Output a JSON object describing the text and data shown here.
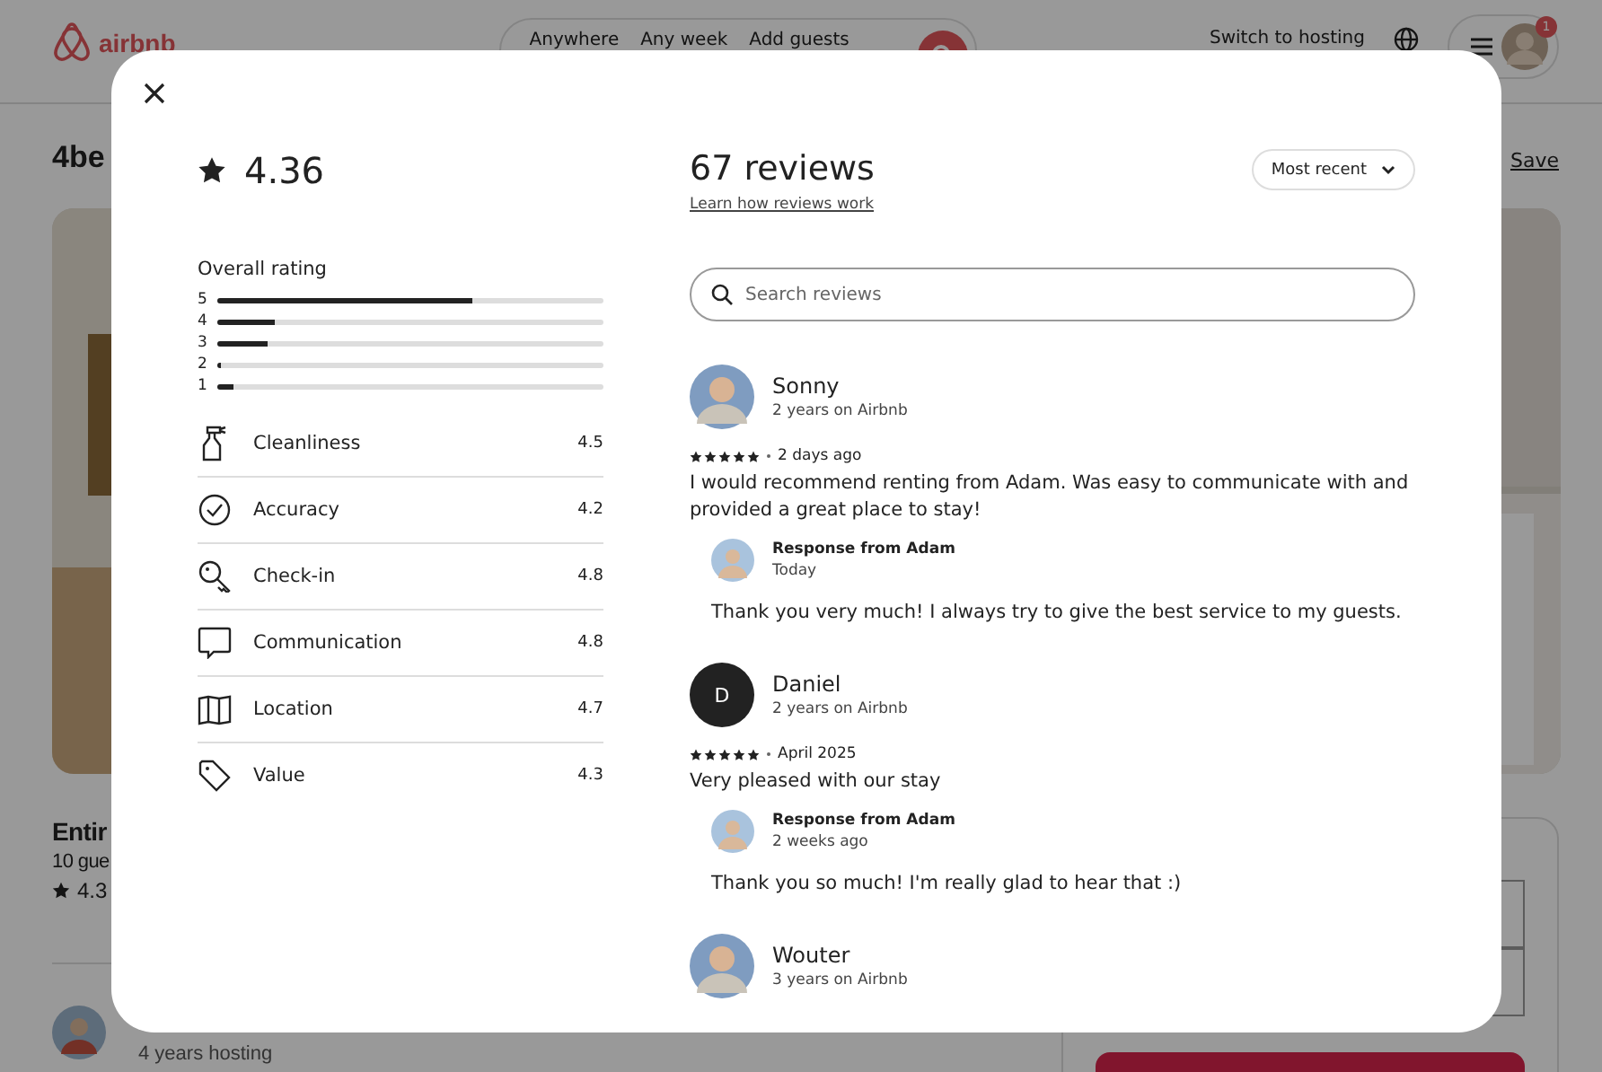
{
  "background_page": {
    "logo": "airbnb",
    "search": [
      "Anywhere",
      "Any week",
      "Add guests"
    ],
    "host_link": "Switch to hosting",
    "notification_count": "1",
    "title": "4be",
    "save": "Save",
    "listing_heading": "Entir",
    "guests": "10 gue",
    "rating": "4.3",
    "host_years": "4 years hosting"
  },
  "modal": {
    "overall_score": "4.36",
    "overall_label": "Overall rating",
    "distribution": [
      {
        "label": "5",
        "level": 0.66
      },
      {
        "label": "4",
        "level": 0.15
      },
      {
        "label": "3",
        "level": 0.13
      },
      {
        "label": "2",
        "level": 0.01
      },
      {
        "label": "1",
        "level": 0.04
      }
    ],
    "categories": [
      {
        "kind": "cleanliness",
        "label": "Cleanliness",
        "score": "4.5"
      },
      {
        "kind": "accuracy",
        "label": "Accuracy",
        "score": "4.2"
      },
      {
        "kind": "checkin",
        "label": "Check-in",
        "score": "4.8"
      },
      {
        "kind": "communication",
        "label": "Communication",
        "score": "4.8"
      },
      {
        "kind": "location",
        "label": "Location",
        "score": "4.7"
      },
      {
        "kind": "value",
        "label": "Value",
        "score": "4.3"
      }
    ],
    "reviews_title": "67 reviews",
    "learn_link": "Learn how reviews work",
    "sort": "Most recent",
    "search_placeholder": "Search reviews",
    "reviews": [
      {
        "name": "Sonny",
        "member": "2 years on Airbnb",
        "stars": 5,
        "date": "2 days ago",
        "text": "I would recommend renting from Adam. Was easy to communicate with and provided a great place to stay!",
        "response": {
          "title": "Response from Adam",
          "date": "Today",
          "text": "Thank you very much! I always try to give the best service to my guests."
        }
      },
      {
        "avatar": {
          "kind": "initial",
          "initial": "D"
        },
        "name": "Daniel",
        "member": "2 years on Airbnb",
        "stars": 5,
        "date": "April 2025",
        "text": "Very pleased with our stay",
        "response": {
          "title": "Response from Adam",
          "date": "2 weeks ago",
          "text": "Thank you so much! I'm really glad to hear that :)"
        }
      },
      {
        "name": "Wouter",
        "member": "3 years on Airbnb"
      }
    ]
  }
}
